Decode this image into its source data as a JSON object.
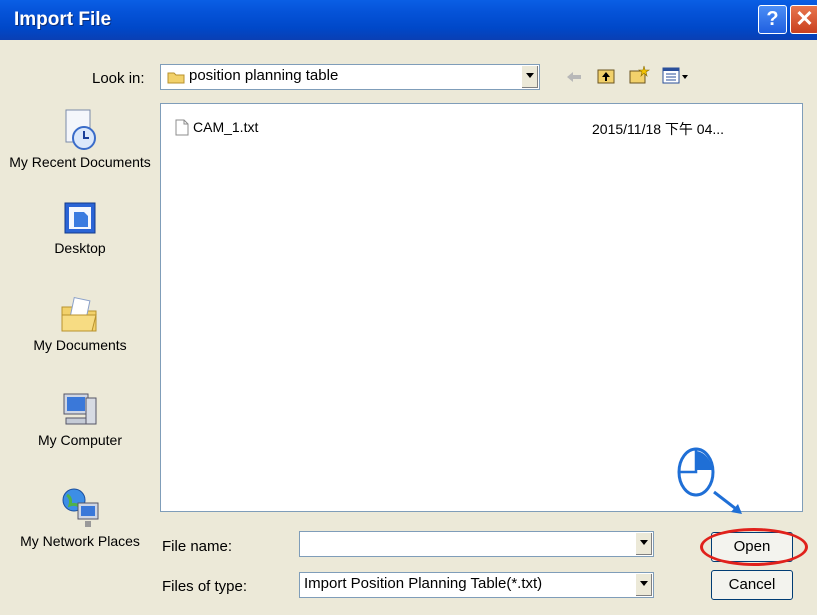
{
  "window": {
    "title": "Import File",
    "help_glyph": "?",
    "close_glyph": "✕"
  },
  "toolbar": {
    "look_in_label": "Look in:",
    "look_in_value": "position planning table"
  },
  "sidebar": {
    "items": [
      {
        "label": "My Recent Documents",
        "icon": "recent-documents-icon"
      },
      {
        "label": "Desktop",
        "icon": "desktop-icon"
      },
      {
        "label": "My Documents",
        "icon": "my-documents-icon"
      },
      {
        "label": "My Computer",
        "icon": "my-computer-icon"
      },
      {
        "label": "My Network Places",
        "icon": "network-places-icon"
      }
    ]
  },
  "files": [
    {
      "name": "CAM_1.txt",
      "date": "2015/11/18 下午 04..."
    }
  ],
  "form": {
    "file_name_label": "File name:",
    "file_name_value": "",
    "file_type_label": "Files of type:",
    "file_type_value": "Import Position Planning Table(*.txt)"
  },
  "buttons": {
    "open": "Open",
    "cancel": "Cancel"
  },
  "colors": {
    "highlight": "#e0211b",
    "pointer": "#1f6fd6"
  }
}
